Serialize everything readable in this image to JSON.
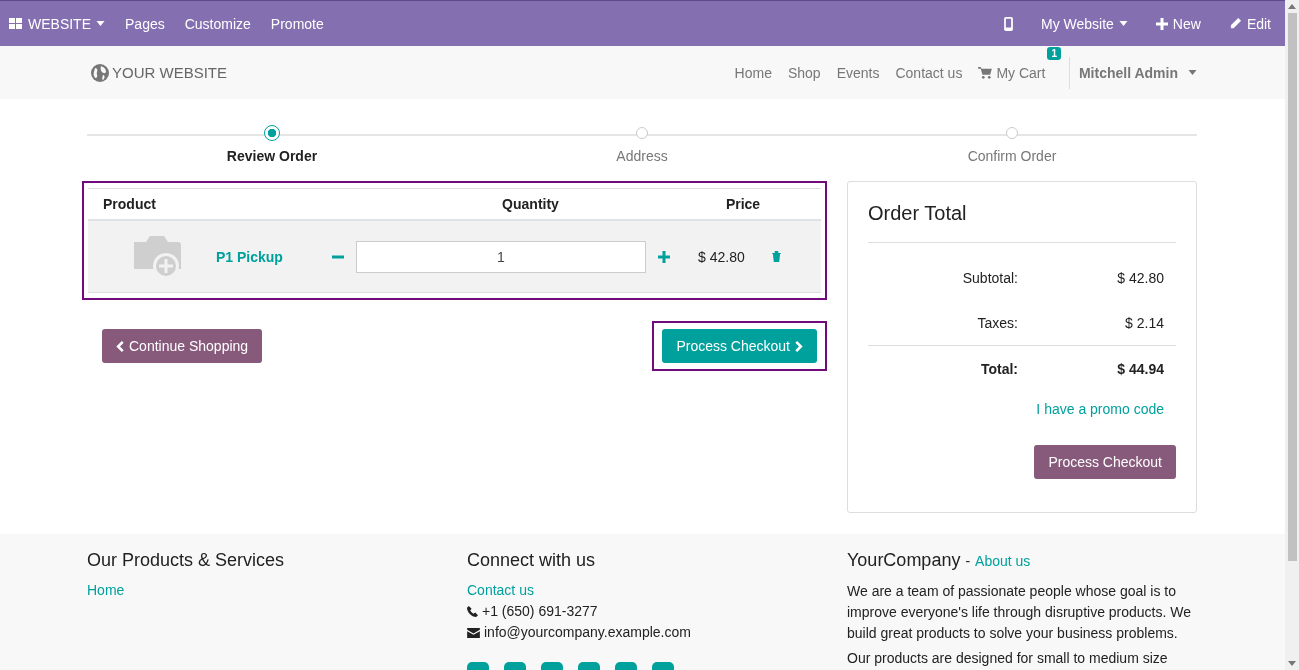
{
  "topbar": {
    "app_menu": "WEBSITE",
    "menus": [
      "Pages",
      "Customize",
      "Promote"
    ],
    "website_menu": "My Website",
    "new": "New",
    "edit": "Edit"
  },
  "header": {
    "logo": "YOUR WEBSITE",
    "nav": [
      "Home",
      "Shop",
      "Events",
      "Contact us"
    ],
    "cart": {
      "label": "My Cart",
      "count": "1"
    },
    "user": "Mitchell Admin"
  },
  "steps": [
    {
      "label": "Review Order",
      "selected": true
    },
    {
      "label": "Address",
      "selected": false
    },
    {
      "label": "Confirm Order",
      "selected": false
    }
  ],
  "cart": {
    "columns": [
      "Product",
      "Quantity",
      "Price"
    ],
    "rows": [
      {
        "name": "P1 Pickup",
        "quantity": "1",
        "price": "$ 42.80"
      }
    ]
  },
  "continue_button": "Continue Shopping",
  "checkout_button": "Process Checkout",
  "order_total": {
    "title": "Order Total",
    "lines": [
      {
        "label": "Subtotal:",
        "value": "$ 42.80",
        "bold": false
      },
      {
        "label": "Taxes:",
        "value": "$ 2.14",
        "bold": false
      },
      {
        "label": "Total:",
        "value": "$ 44.94",
        "bold": true
      }
    ],
    "promo": "I have a promo code",
    "button": "Process Checkout"
  },
  "footer": {
    "products": {
      "title": "Our Products & Services",
      "links": [
        "Home"
      ]
    },
    "connect": {
      "title": "Connect with us",
      "link": "Contact us",
      "phone": "+1 (650) 691-3277",
      "email": "info@yourcompany.example.com"
    },
    "company": {
      "title": "YourCompany",
      "separator": "-",
      "link": "About us",
      "paragraphs": [
        "We are a team of passionate people whose goal is to improve everyone's life through disruptive products. We build great products to solve your business problems.",
        "Our products are designed for small to medium size"
      ]
    }
  }
}
